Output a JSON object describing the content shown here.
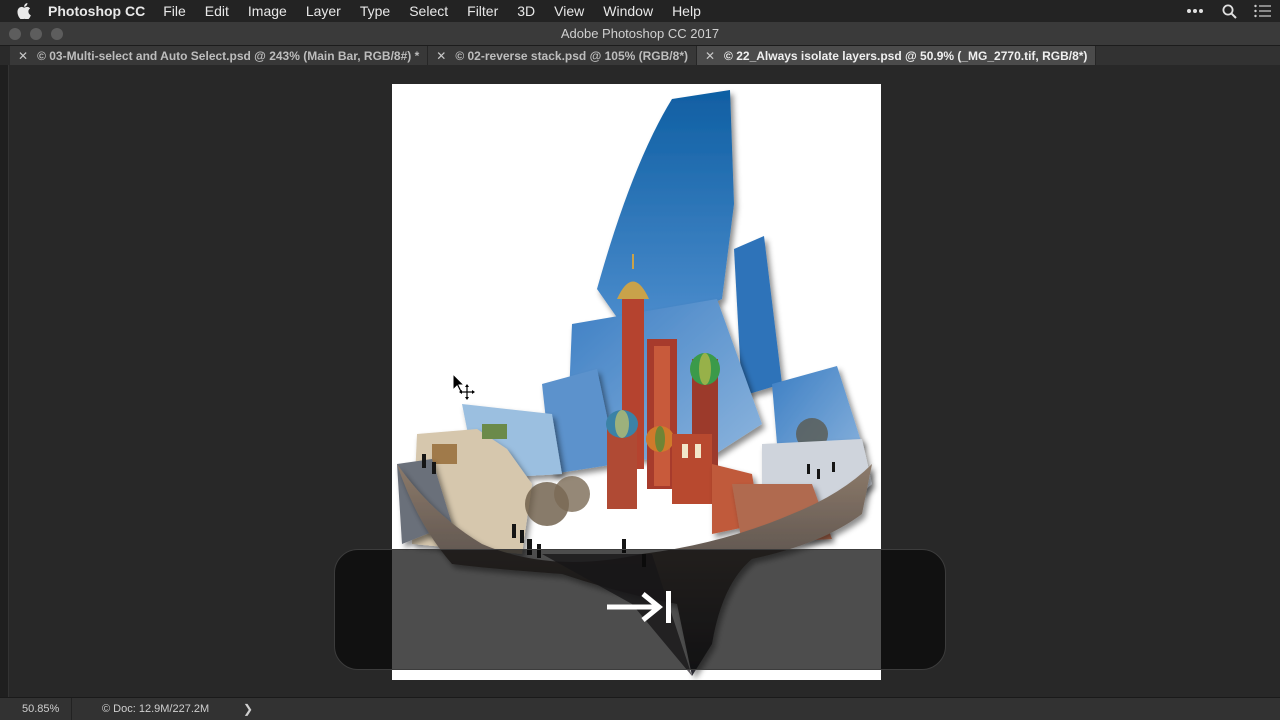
{
  "menubar": {
    "app_name": "Photoshop CC",
    "items": [
      "File",
      "Edit",
      "Image",
      "Layer",
      "Type",
      "Select",
      "Filter",
      "3D",
      "View",
      "Window",
      "Help"
    ],
    "icons": [
      "apple-logo",
      "more-icon",
      "search-icon",
      "notification-list-icon"
    ]
  },
  "window": {
    "title": "Adobe Photoshop CC 2017"
  },
  "tabs": [
    {
      "label": "© 03-Multi-select and Auto Select.psd @ 243% (Main Bar, RGB/8#) *",
      "active": false
    },
    {
      "label": "© 02-reverse stack.psd @ 105% (RGB/8*)",
      "active": false
    },
    {
      "label": "© 22_Always isolate layers.psd @ 50.9% (_MG_2770.tif, RGB/8*)",
      "active": true
    }
  ],
  "canvas": {
    "content": "photo-collage-st-basils-cathedral",
    "colors": {
      "sky": "#1f6db3",
      "cathedral_red": "#b5432f",
      "ground": "#3a3a44"
    }
  },
  "overlay": {
    "key_glyph": "→I"
  },
  "status": {
    "zoom": "50.85%",
    "doc_info": "© Doc: 12.9M/227.2M",
    "arrow": "❯"
  }
}
